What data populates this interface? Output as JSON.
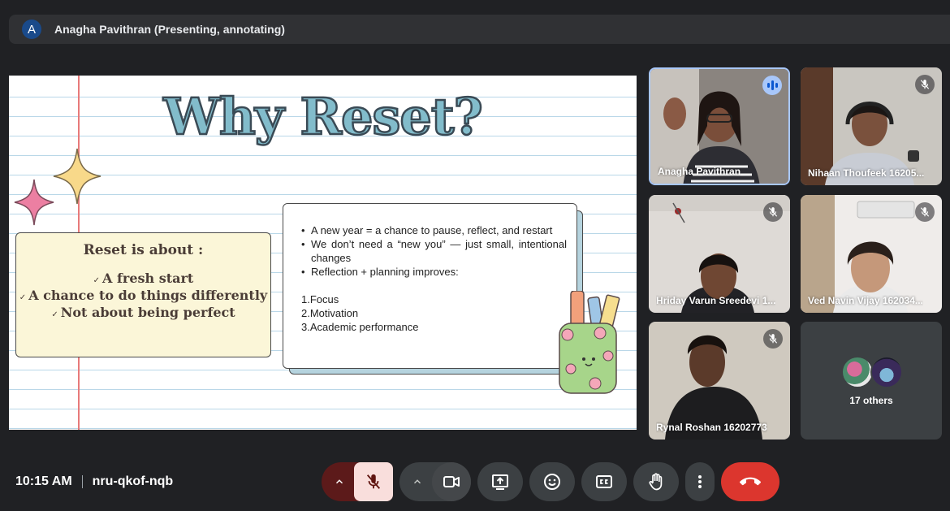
{
  "presenter_bar": {
    "avatar_letter": "A",
    "label": "Anagha Pavithran (Presenting, annotating)"
  },
  "slide": {
    "title": "Why Reset?",
    "reset_box": {
      "heading": "Reset is about :",
      "items": [
        {
          "check": "✓",
          "text": "A fresh start"
        },
        {
          "check": "✓",
          "text": "A chance to do things differently"
        },
        {
          "check": "✓",
          "text": "Not about being perfect"
        }
      ]
    },
    "bullets": [
      "A new year = a chance to pause, reflect, and restart",
      "We don’t need a “new you” — just small, intentional changes",
      " Reflection + planning improves:"
    ],
    "numbered": [
      "1.Focus",
      "2.Motivation",
      "3.Academic performance"
    ]
  },
  "participants": [
    {
      "name": "Anagha Pavithran",
      "speaking": true
    },
    {
      "name": "Nihaan Thoufeek 16205...",
      "muted": true
    },
    {
      "name": "Hriday Varun Sreedevi 1...",
      "muted": true
    },
    {
      "name": "Ved Navin Vijay 162034...",
      "muted": true
    },
    {
      "name": "Rynal Roshan 16202773",
      "muted": true
    }
  ],
  "others": {
    "label": "17 others"
  },
  "meeting": {
    "time": "10:15 AM",
    "code": "nru-qkof-nqb"
  },
  "icons": {
    "mic": "mic-off-icon",
    "camera": "videocam-icon",
    "present": "present-to-all-icon",
    "reactions": "emoji-icon",
    "captions": "closed-caption-icon",
    "raise_hand": "raise-hand-icon",
    "more": "more-vert-icon",
    "leave": "call-end-icon"
  },
  "colors": {
    "background": "#202124",
    "leave": "#dc362e",
    "mic_off": "#f9dedc",
    "slide_title": "#82bccb"
  }
}
